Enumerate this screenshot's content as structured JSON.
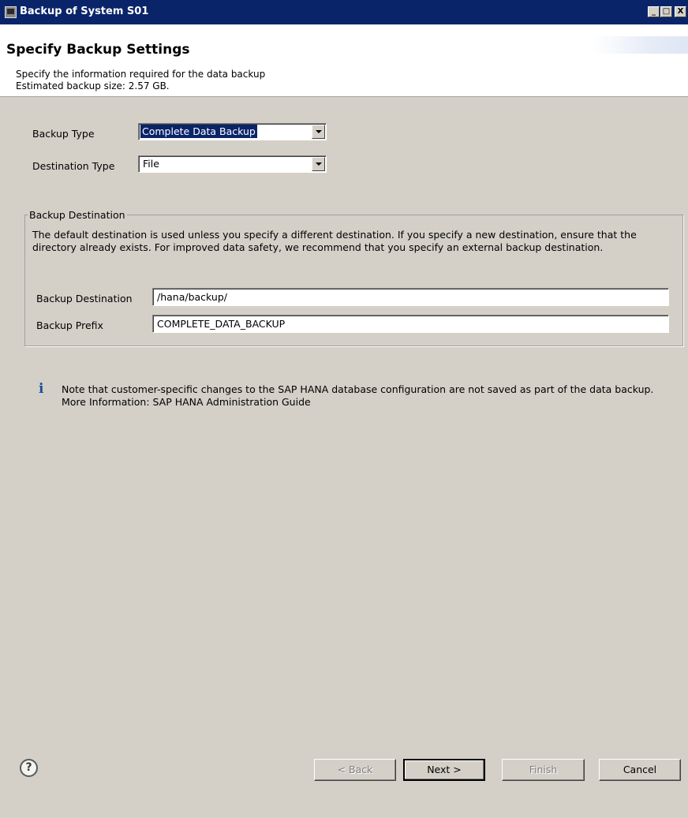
{
  "window": {
    "title": "Backup of System S01",
    "icon": "app-window-icon",
    "controls": {
      "minimize": "_",
      "maximize": "□",
      "close": "X"
    }
  },
  "header": {
    "title": "Specify Backup Settings",
    "description": "Specify the information required for the data backup",
    "estimate": "Estimated backup size: 2.57 GB."
  },
  "form": {
    "backup_type": {
      "label": "Backup Type",
      "value": "Complete Data Backup"
    },
    "destination_type": {
      "label": "Destination Type",
      "value": "File"
    }
  },
  "group": {
    "legend": "Backup Destination",
    "text": "The default destination is used unless you specify a different destination. If you specify a new destination, ensure that the directory already exists. For improved data safety, we recommend that you specify an external backup destination.",
    "destination": {
      "label": "Backup Destination",
      "value": "/hana/backup/"
    },
    "prefix": {
      "label": "Backup Prefix",
      "value": "COMPLETE_DATA_BACKUP"
    }
  },
  "note": {
    "icon": "info-icon",
    "line1": "Note that customer-specific changes to the SAP HANA database configuration are not saved as part of the data backup.",
    "line2": "More Information: SAP HANA Administration Guide"
  },
  "footer": {
    "help_icon": "help-icon",
    "back": "< Back",
    "next": "Next >",
    "finish": "Finish",
    "cancel": "Cancel"
  }
}
